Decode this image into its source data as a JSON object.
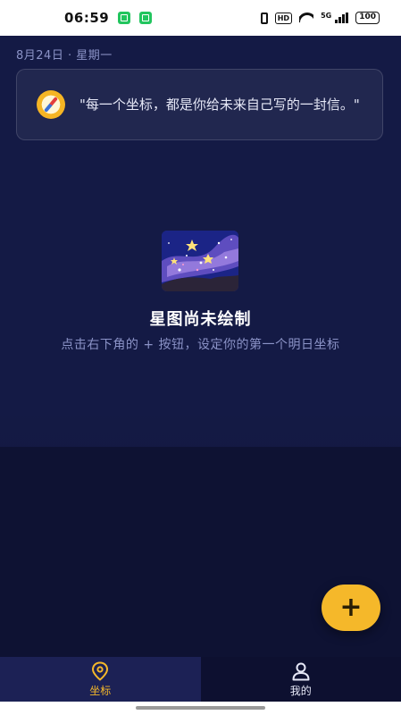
{
  "status_bar": {
    "time": "06:59",
    "hd": "HD",
    "network": "5G",
    "battery": "100"
  },
  "header": {
    "date": "8月24日 · 星期一"
  },
  "quote": {
    "icon": "compass-icon",
    "text": "\"每一个坐标，都是你给未来自己写的一封信。\""
  },
  "empty_state": {
    "illustration": "starry-night-illustration",
    "title": "星图尚未绘制",
    "subtitle": "点击右下角的 + 按钮，设定你的第一个明日坐标"
  },
  "fab": {
    "label": "+"
  },
  "bottom_nav": {
    "items": [
      {
        "label": "坐标",
        "icon": "location-pin-icon",
        "active": true
      },
      {
        "label": "我的",
        "icon": "user-icon",
        "active": false
      }
    ]
  },
  "colors": {
    "background": "#141a45",
    "accent": "#f5b82a",
    "muted_text": "#8b93c7"
  }
}
